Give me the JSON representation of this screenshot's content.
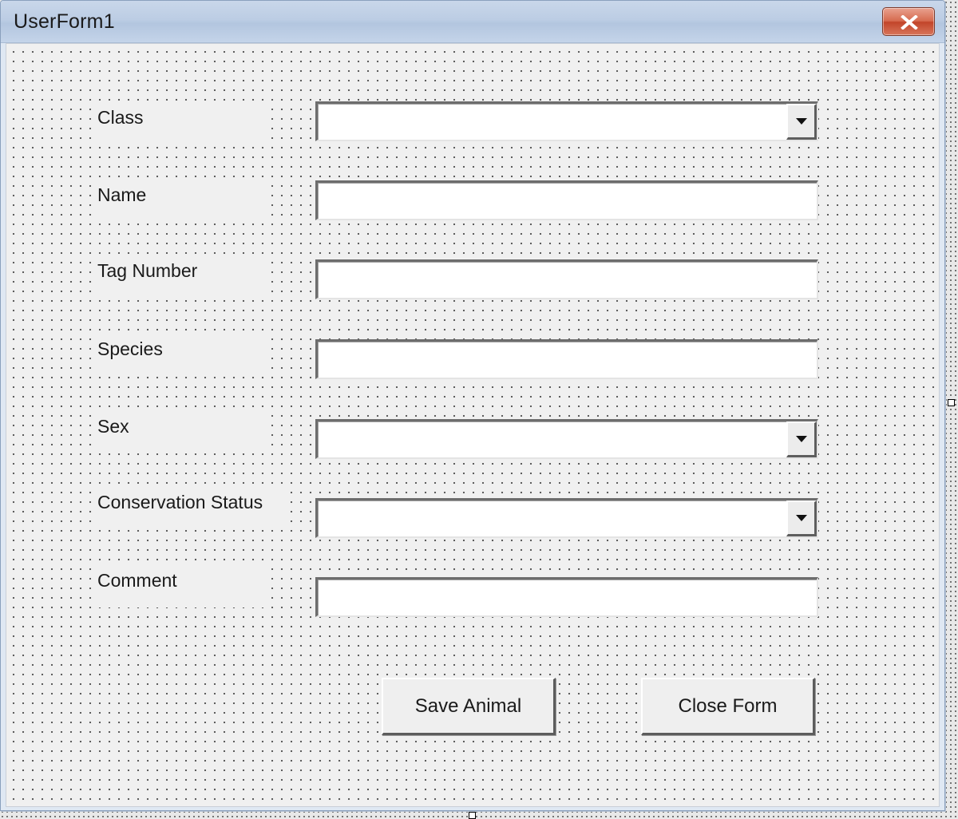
{
  "window": {
    "title": "UserForm1"
  },
  "form": {
    "fields": [
      {
        "label": "Class",
        "control": "combobox",
        "value": ""
      },
      {
        "label": "Name",
        "control": "textbox",
        "value": ""
      },
      {
        "label": "Tag Number",
        "control": "textbox",
        "value": ""
      },
      {
        "label": "Species",
        "control": "textbox",
        "value": ""
      },
      {
        "label": "Sex",
        "control": "combobox",
        "value": ""
      },
      {
        "label": "Conservation Status",
        "control": "combobox",
        "value": ""
      },
      {
        "label": "Comment",
        "control": "textbox",
        "value": ""
      }
    ],
    "buttons": {
      "save": "Save Animal",
      "close": "Close Form"
    }
  },
  "icons": {
    "close": "close-x-icon",
    "dropdown": "dropdown-arrow-icon"
  },
  "colors": {
    "title_bar": "#bccde4",
    "close_button": "#c8472c",
    "form_background": "#f0f0f0",
    "grid_dots": "#555555"
  }
}
